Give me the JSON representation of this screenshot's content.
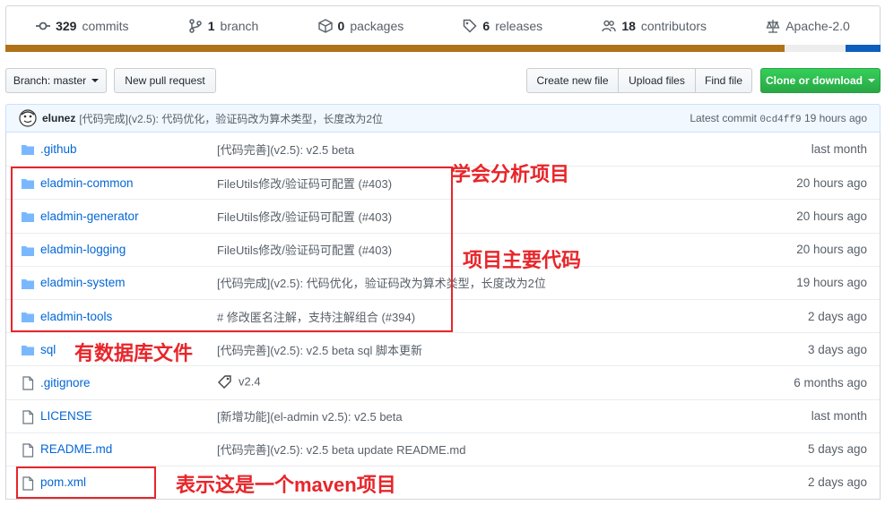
{
  "stats": {
    "commits_count": "329",
    "commits_label": "commits",
    "branch_count": "1",
    "branch_label": "branch",
    "packages_count": "0",
    "packages_label": "packages",
    "releases_count": "6",
    "releases_label": "releases",
    "contributors_count": "18",
    "contributors_label": "contributors",
    "license": "Apache-2.0"
  },
  "language_bar_colors": {
    "java": "#b07219",
    "other": "#ededed",
    "blue": "#0e5fbd"
  },
  "toolbar": {
    "branch_label": "Branch: master",
    "new_pull_request": "New pull request",
    "create_new_file": "Create new file",
    "upload_files": "Upload files",
    "find_file": "Find file",
    "clone_or_download": "Clone or download"
  },
  "latest_commit": {
    "author": "elunez",
    "message": "[代码完成](v2.5): 代码优化，验证码改为算术类型，长度改为2位",
    "prefix": "Latest commit",
    "sha": "0cd4ff9",
    "age": "19 hours ago"
  },
  "files": [
    {
      "name": ".github",
      "type": "folder",
      "message": "[代码完善](v2.5): v2.5 beta",
      "age": "last month"
    },
    {
      "name": "eladmin-common",
      "type": "folder",
      "message": "FileUtils修改/验证码可配置 (#403)",
      "age": "20 hours ago"
    },
    {
      "name": "eladmin-generator",
      "type": "folder",
      "message": "FileUtils修改/验证码可配置 (#403)",
      "age": "20 hours ago"
    },
    {
      "name": "eladmin-logging",
      "type": "folder",
      "message": "FileUtils修改/验证码可配置 (#403)",
      "age": "20 hours ago"
    },
    {
      "name": "eladmin-system",
      "type": "folder",
      "message": "[代码完成](v2.5): 代码优化，验证码改为算术类型，长度改为2位",
      "age": "19 hours ago"
    },
    {
      "name": "eladmin-tools",
      "type": "folder",
      "message": "# 修改匿名注解，支持注解组合 (#394)",
      "age": "2 days ago"
    },
    {
      "name": "sql",
      "type": "folder",
      "message": "[代码完善](v2.5): v2.5 beta sql 脚本更新",
      "age": "3 days ago"
    },
    {
      "name": ".gitignore",
      "type": "file",
      "message": "v2.4",
      "age": "6 months ago"
    },
    {
      "name": "LICENSE",
      "type": "file",
      "message": "[新增功能](el-admin v2.5): v2.5 beta",
      "age": "last month"
    },
    {
      "name": "README.md",
      "type": "file",
      "message": "[代码完善](v2.5): v2.5 beta update README.md",
      "age": "5 days ago"
    },
    {
      "name": "pom.xml",
      "type": "file",
      "message": "",
      "age": "2 days ago"
    }
  ],
  "annotations": {
    "learn": "学会分析项目",
    "main_code": "项目主要代码",
    "database": "有数据库文件",
    "maven": "表示这是一个maven项目"
  }
}
